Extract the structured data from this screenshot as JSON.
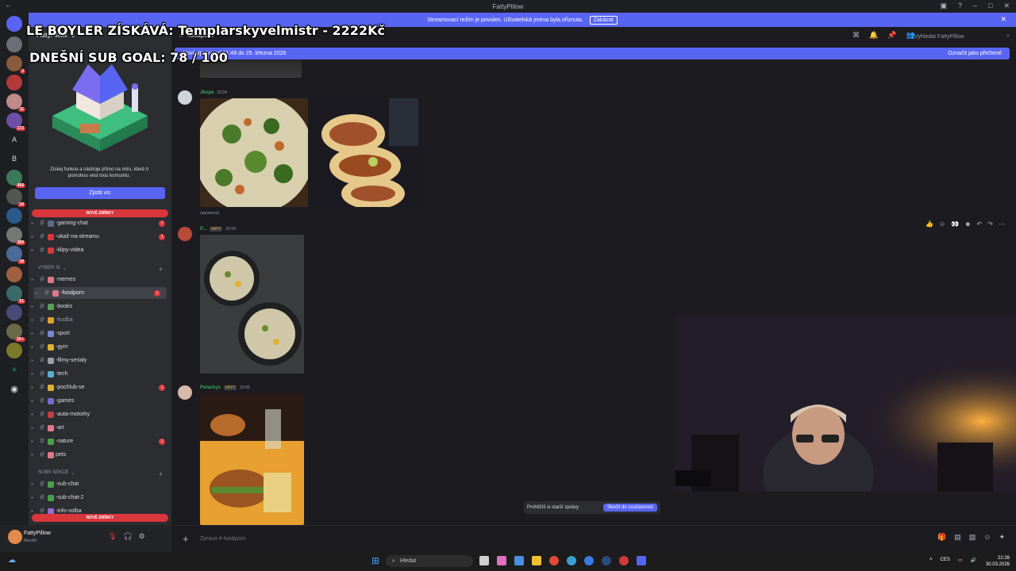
{
  "window": {
    "title": "FattyPillow"
  },
  "stream_banner": {
    "text": "Streamovací režim je povolen. Uživatelská jména byla ořiznuta.",
    "button": "Zakázat"
  },
  "overlay": {
    "line1": "LE BOYLER ZÍSKÁVÁ: Templarskyvelmistr - 2222Kč",
    "line2": "DNEŠNÍ SUB GOAL: 78 / 100"
  },
  "server_rail": {
    "badges": [
      "2",
      "11",
      "172",
      "1",
      "499",
      "14",
      "389",
      "18",
      "51",
      "1K+"
    ],
    "letters": [
      "A",
      "B"
    ]
  },
  "sidebar": {
    "server_name": "FattyPillow",
    "promo_text": "Získej funkce a nástroje přímo na míru, které ti pomohou vést tvou komunitu.",
    "promo_button": "Zjistit víc",
    "new_mentions": "NOVÉ ZMÍNKY",
    "channels_top": [
      {
        "name": "-gaming-chat",
        "badge": "7"
      },
      {
        "name": "-ukaž-na-streamu",
        "badge": "2"
      },
      {
        "name": "-klipy-videa",
        "badge": ""
      }
    ],
    "category1": "VYBER SI",
    "channels_mid": [
      {
        "name": "-memes",
        "badge": ""
      },
      {
        "name": "-foodporn",
        "badge": "1"
      },
      {
        "name": "-books",
        "badge": ""
      },
      {
        "name": "-hudba",
        "badge": ""
      },
      {
        "name": "-sport",
        "badge": ""
      },
      {
        "name": "-gym",
        "badge": ""
      },
      {
        "name": "-filmy-serialy",
        "badge": ""
      },
      {
        "name": "-tech",
        "badge": ""
      },
      {
        "name": "-pochlub-se",
        "badge": "1"
      },
      {
        "name": "-games",
        "badge": ""
      },
      {
        "name": "-auta-motorky",
        "badge": ""
      },
      {
        "name": "-art",
        "badge": ""
      },
      {
        "name": "-nature",
        "badge": "1"
      },
      {
        "name": "pets",
        "badge": ""
      }
    ],
    "category2": "SUBS SEKCE",
    "channels_sub": [
      {
        "name": "-sub-chat",
        "badge": ""
      },
      {
        "name": "-sub-chat-2",
        "badge": ""
      },
      {
        "name": "-info-volba",
        "badge": ""
      }
    ]
  },
  "user": {
    "name": "FattyPillow",
    "status": "Nerušit"
  },
  "main": {
    "channel": "-foodporn",
    "search_placeholder": "Vyhledat FattyPillow",
    "new_messages": "Nové zprávy od 21:48 do 25. března 2026",
    "mark_read": "Označit jako přečtené",
    "messages": [
      {
        "user": "Jkopa",
        "tag": "",
        "time": "22:04",
        "caption": "(upraveno)"
      },
      {
        "user": "P...",
        "tag": "FATY",
        "time": "22:04",
        "caption": ""
      },
      {
        "user": "Polackys",
        "tag": "FATY",
        "time": "22:05",
        "caption": ""
      }
    ],
    "jump_text": "Prohlížíš si starší zprávy",
    "jump_button": "Skočit do současnosti",
    "composer_placeholder": "Zpráva #-foodporn"
  },
  "taskbar": {
    "search": "Hledat",
    "lang": "CES",
    "time": "22:26",
    "date": "30.03.2026"
  }
}
